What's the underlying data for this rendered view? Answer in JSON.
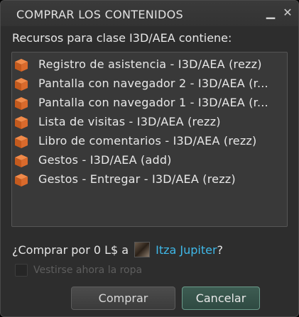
{
  "window": {
    "title": "COMPRAR LOS CONTENIDOS",
    "minimize_symbol": "▁",
    "close_symbol": "✕"
  },
  "subtitle": "Recursos para clase I3D/AEA contiene:",
  "items": [
    {
      "label": "Registro de asistencia - I3D/AEA (rezz)",
      "icon": "object-cube-icon"
    },
    {
      "label": "Pantalla con navegador 2 - I3D/AEA (r...",
      "icon": "object-cube-icon"
    },
    {
      "label": "Pantalla con navegador 1 - I3D/AEA (r...",
      "icon": "object-cube-icon"
    },
    {
      "label": "Lista de visitas - I3D/AEA (rezz)",
      "icon": "object-cube-icon"
    },
    {
      "label": "Libro de comentarios - I3D/AEA (rezz)",
      "icon": "object-cube-icon"
    },
    {
      "label": "Gestos - I3D/AEA (add)",
      "icon": "object-cube-icon"
    },
    {
      "label": "Gestos - Entregar  - I3D/AEA (rezz)",
      "icon": "object-cube-icon"
    }
  ],
  "purchase": {
    "prompt": "¿Comprar por 0 L$ a",
    "owner_name": "Itza Jupiter",
    "suffix": "?"
  },
  "wear_checkbox": {
    "label": "Vestirse ahora la ropa",
    "checked": false,
    "enabled": false
  },
  "buttons": {
    "buy_label": "Comprar",
    "cancel_label": "Cancelar"
  },
  "colors": {
    "link": "#3fb8e8",
    "cube_light": "#f08a4a",
    "cube_dark": "#c45a1e"
  }
}
